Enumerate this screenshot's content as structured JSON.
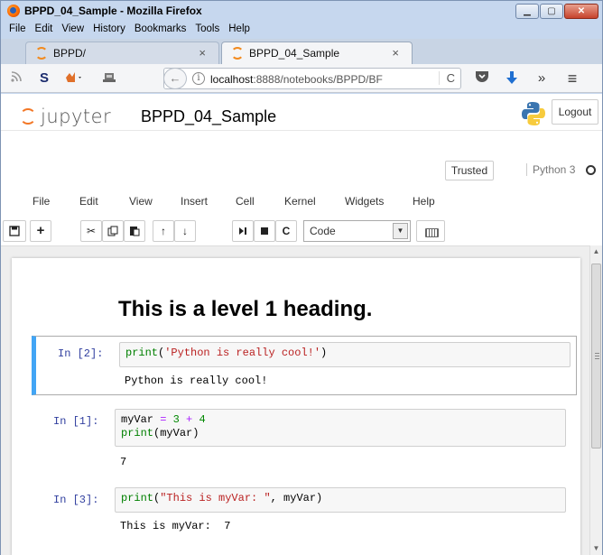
{
  "window": {
    "title": "BPPD_04_Sample - Mozilla Firefox",
    "buttons": {
      "minimize": "▁",
      "maximize": "▢",
      "close": "✕"
    }
  },
  "menu": [
    "File",
    "Edit",
    "View",
    "History",
    "Bookmarks",
    "Tools",
    "Help"
  ],
  "tabs": [
    {
      "label": "BPPD/",
      "close": "×"
    },
    {
      "label": "BPPD_04_Sample",
      "close": "×"
    }
  ],
  "nav": {
    "url_host": "localhost",
    "url_rest": ":8888/notebooks/BPPD/BF",
    "info_glyph": "i",
    "back_glyph": "←",
    "reload_glyph": "C",
    "overflow_glyph": "»",
    "menu_glyph": "≡"
  },
  "jupyter": {
    "logo_text": "jupyter",
    "notebook_name": "BPPD_04_Sample",
    "logout_label": "Logout",
    "trusted_label": "Trusted",
    "kernel_name": "Python 3",
    "menu": [
      "File",
      "Edit",
      "View",
      "Insert",
      "Cell",
      "Kernel",
      "Widgets",
      "Help"
    ],
    "cell_type": "Code"
  },
  "notebook": {
    "heading": "This is a level 1 heading.",
    "cells": [
      {
        "prompt": "In [2]:",
        "output": "Python is really cool!"
      },
      {
        "prompt": "In [1]:",
        "output": "7"
      },
      {
        "prompt": "In [3]:",
        "output": "This is myVar:  7"
      }
    ]
  },
  "colors": {
    "selected_cell_border": "#42a5f5",
    "prompt": "#303f9f",
    "jupyter_orange": "#f37726"
  }
}
